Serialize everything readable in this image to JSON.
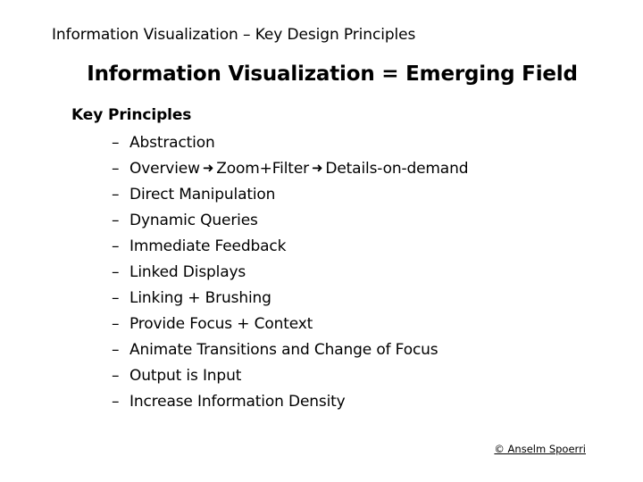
{
  "slide": {
    "header": "Information Visualization – Key Design Principles",
    "title": "Information Visualization = Emerging Field",
    "section_heading": "Key Principles",
    "bullet_dash": "–",
    "arrow_glyph": "➜",
    "principles": [
      {
        "text": "Abstraction"
      },
      {
        "part1": "Overview",
        "part2": "Zoom+Filter",
        "part3": "Details-on-demand"
      },
      {
        "text": "Direct Manipulation"
      },
      {
        "text": "Dynamic Queries"
      },
      {
        "text": "Immediate Feedback"
      },
      {
        "text": "Linked Displays"
      },
      {
        "text": "Linking + Brushing"
      },
      {
        "text": "Provide Focus + Context"
      },
      {
        "text": "Animate Transitions and Change of Focus"
      },
      {
        "text": "Output is Input"
      },
      {
        "text": "Increase Information Density"
      }
    ],
    "footer": "© Anselm Spoerri",
    "colors": {
      "background": "#ffffff",
      "text": "#000000"
    }
  }
}
